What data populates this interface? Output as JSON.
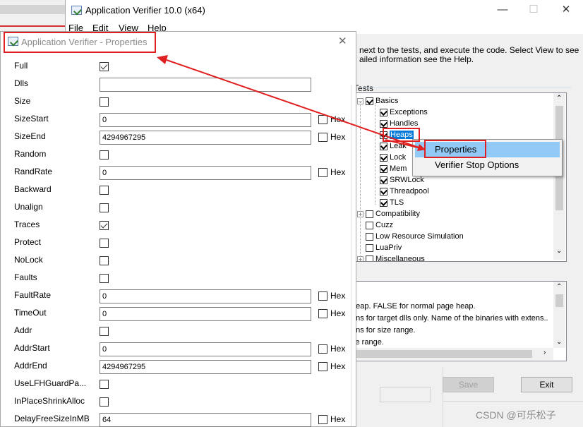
{
  "main_window": {
    "title": "Application Verifier 10.0 (x64)",
    "controls": {
      "minimize": "—",
      "maximize": "☐",
      "close": "✕"
    },
    "menu": {
      "file": "File",
      "edit": "Edit",
      "view": "View",
      "help": "Help"
    },
    "help_text": {
      "line1": "next to the tests, and execute the code. Select View to see",
      "line2": "ailed information see the Help."
    },
    "tests_label": "Tests",
    "tree": [
      {
        "label": "Basics",
        "checked": true,
        "level": 0,
        "expander": "−"
      },
      {
        "label": "Exceptions",
        "checked": true,
        "level": 1
      },
      {
        "label": "Handles",
        "checked": true,
        "level": 1
      },
      {
        "label": "Heaps",
        "checked": true,
        "level": 1,
        "selected": true
      },
      {
        "label": "Leak",
        "checked": true,
        "level": 1
      },
      {
        "label": "Lock",
        "checked": true,
        "level": 1
      },
      {
        "label": "Mem",
        "checked": true,
        "level": 1
      },
      {
        "label": "SRWLock",
        "checked": true,
        "level": 1
      },
      {
        "label": "Threadpool",
        "checked": true,
        "level": 1
      },
      {
        "label": "TLS",
        "checked": true,
        "level": 1
      },
      {
        "label": "Compatibility",
        "checked": false,
        "level": 0,
        "expander": "+"
      },
      {
        "label": "Cuzz",
        "checked": false,
        "level": 0
      },
      {
        "label": "Low Resource Simulation",
        "checked": false,
        "level": 0
      },
      {
        "label": "LuaPriv",
        "checked": false,
        "level": 0
      },
      {
        "label": "Miscellaneous",
        "checked": false,
        "level": 0,
        "expander": "+"
      }
    ],
    "description_lines": [
      "heap. FALSE for normal page heap.",
      "ons for target dlls only. Name of the binaries with extens..",
      "ons for size range.",
      "ze range."
    ],
    "buttons": {
      "save": "Save",
      "exit": "Exit"
    }
  },
  "context_menu": {
    "items": [
      "Properties",
      "Verifier Stop Options"
    ],
    "highlighted": 0
  },
  "properties_dialog": {
    "title": "Application Verifier - Properties",
    "close": "✕",
    "rows": [
      {
        "label": "Full",
        "type": "checkbox",
        "checked": true
      },
      {
        "label": "Dlls",
        "type": "text",
        "value": ""
      },
      {
        "label": "Size",
        "type": "checkbox",
        "checked": false
      },
      {
        "label": "SizeStart",
        "type": "text",
        "value": "0",
        "hex": "Hex"
      },
      {
        "label": "SizeEnd",
        "type": "text",
        "value": "4294967295",
        "hex": "Hex"
      },
      {
        "label": "Random",
        "type": "checkbox",
        "checked": false
      },
      {
        "label": "RandRate",
        "type": "text",
        "value": "0",
        "hex": "Hex"
      },
      {
        "label": "Backward",
        "type": "checkbox",
        "checked": false
      },
      {
        "label": "Unalign",
        "type": "checkbox",
        "checked": false
      },
      {
        "label": "Traces",
        "type": "checkbox",
        "checked": true
      },
      {
        "label": "Protect",
        "type": "checkbox",
        "checked": false
      },
      {
        "label": "NoLock",
        "type": "checkbox",
        "checked": false
      },
      {
        "label": "Faults",
        "type": "checkbox",
        "checked": false
      },
      {
        "label": "FaultRate",
        "type": "text",
        "value": "0",
        "hex": "Hex"
      },
      {
        "label": "TimeOut",
        "type": "text",
        "value": "0",
        "hex": "Hex"
      },
      {
        "label": "Addr",
        "type": "checkbox",
        "checked": false
      },
      {
        "label": "AddrStart",
        "type": "text",
        "value": "0",
        "hex": "Hex"
      },
      {
        "label": "AddrEnd",
        "type": "text",
        "value": "4294967295",
        "hex": "Hex"
      },
      {
        "label": "UseLFHGuardPa...",
        "type": "checkbox",
        "checked": false
      },
      {
        "label": "InPlaceShrinkAlloc",
        "type": "checkbox",
        "checked": false
      },
      {
        "label": "DelayFreeSizeInMB",
        "type": "text",
        "value": "64",
        "hex": "Hex"
      }
    ]
  },
  "watermark": "CSDN @可乐松子",
  "colors": {
    "annotation_red": "#e02020",
    "selection_blue": "#0078d7",
    "menu_highlight": "#91c9f7"
  }
}
